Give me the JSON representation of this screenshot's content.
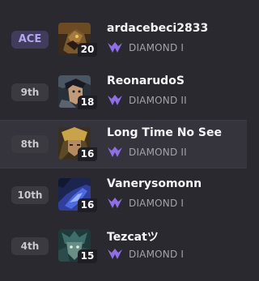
{
  "colors": {
    "background": "#2a2930",
    "highlight_row": "#35343c",
    "ace_badge_bg": "#423c5c",
    "ace_badge_text": "#b3a6ee",
    "rank_badge_bg": "#3b3a41",
    "tier_icon": "#8f6fe8"
  },
  "players": [
    {
      "rank": "ACE",
      "name": "ardacebeci2833",
      "level": "20",
      "tier": "DIAMOND I",
      "tier_icon": "diamond-tier-icon",
      "ace": true,
      "highlighted": false
    },
    {
      "rank": "9th",
      "name": "ReonarudoS",
      "level": "18",
      "tier": "DIAMOND II",
      "tier_icon": "diamond-tier-icon",
      "ace": false,
      "highlighted": false
    },
    {
      "rank": "8th",
      "name": "Long Time No See",
      "level": "16",
      "tier": "DIAMOND II",
      "tier_icon": "diamond-tier-icon",
      "ace": false,
      "highlighted": true
    },
    {
      "rank": "10th",
      "name": "Vanerysomonn",
      "level": "16",
      "tier": "DIAMOND I",
      "tier_icon": "diamond-tier-icon",
      "ace": false,
      "highlighted": false
    },
    {
      "rank": "4th",
      "name": "Tezcatツ",
      "level": "15",
      "tier": "DIAMOND I",
      "tier_icon": "diamond-tier-icon",
      "ace": false,
      "highlighted": false
    }
  ]
}
